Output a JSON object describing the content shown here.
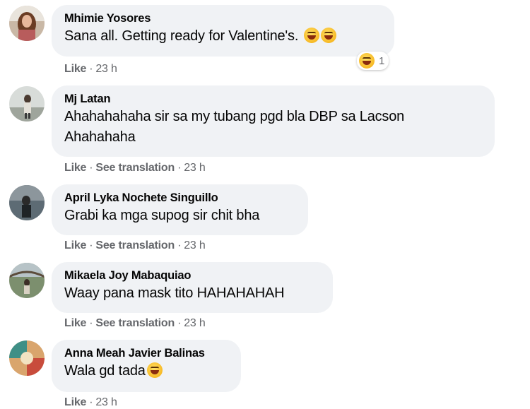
{
  "comments": [
    {
      "author": "Mhimie Yosores",
      "text": "Sana all. Getting ready for Valentine's.",
      "emojis": [
        "rofl-emoji",
        "tongue-emoji"
      ],
      "actions": {
        "like": "Like",
        "time": "23 h"
      },
      "reaction": {
        "icon": "haha-reaction-icon",
        "count": "1"
      }
    },
    {
      "author": "Mj Latan",
      "text_lines": [
        "Ahahahahaha sir sa my tubang pgd bla DBP sa Lacson",
        "Ahahahaha"
      ],
      "actions": {
        "like": "Like",
        "translate": "See translation",
        "time": "23 h"
      }
    },
    {
      "author": "April Lyka Nochete Singuillo",
      "text": "Grabi ka mga supog sir chit bha",
      "actions": {
        "like": "Like",
        "translate": "See translation",
        "time": "23 h"
      }
    },
    {
      "author": "Mikaela Joy Mabaquiao",
      "text": "Waay pana mask tito HAHAHAHAH",
      "actions": {
        "like": "Like",
        "translate": "See translation",
        "time": "23 h"
      }
    },
    {
      "author": "Anna Meah Javier Balinas",
      "text": "Wala gd tada",
      "emojis": [
        "rofl-emoji"
      ],
      "actions": {
        "like": "Like",
        "time": "23 h"
      }
    }
  ],
  "separator": "·",
  "colors": {
    "bubble": "#f0f2f5",
    "meta": "#65676b",
    "text": "#050505"
  }
}
